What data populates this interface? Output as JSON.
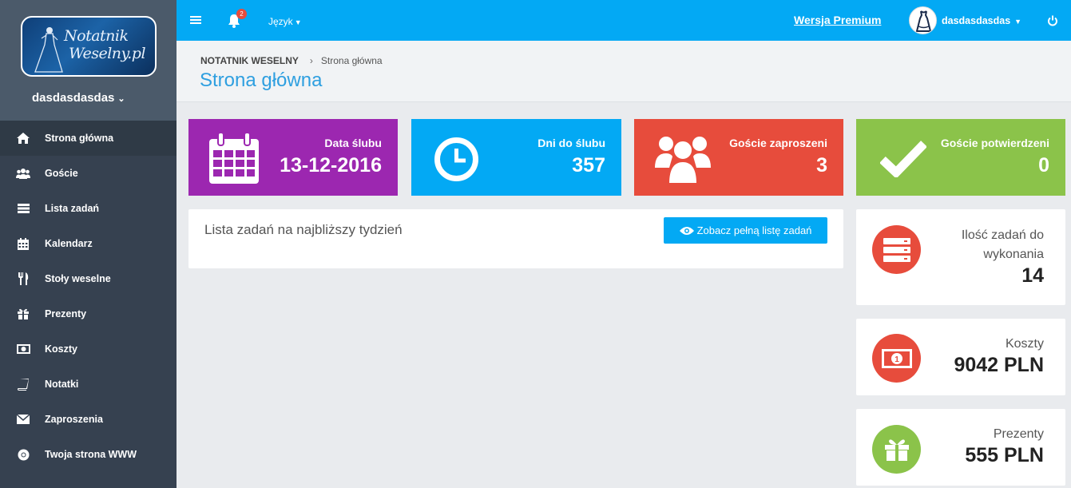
{
  "sidebar": {
    "logo_text_line1": "Notatnik",
    "logo_text_line2": "Weselny.pl",
    "user_name": "dasdasdasdas",
    "items": [
      {
        "label": "Strona główna",
        "icon": "home-icon"
      },
      {
        "label": "Goście",
        "icon": "users-icon"
      },
      {
        "label": "Lista zadań",
        "icon": "tasks-icon"
      },
      {
        "label": "Kalendarz",
        "icon": "calendar-icon"
      },
      {
        "label": "Stoły weselne",
        "icon": "cutlery-icon"
      },
      {
        "label": "Prezenty",
        "icon": "gift-icon"
      },
      {
        "label": "Koszty",
        "icon": "money-icon"
      },
      {
        "label": "Notatki",
        "icon": "book-icon"
      },
      {
        "label": "Zaproszenia",
        "icon": "envelope-icon"
      },
      {
        "label": "Twoja strona WWW",
        "icon": "chrome-icon"
      }
    ]
  },
  "topbar": {
    "notification_count": "2",
    "language_label": "Język",
    "premium_label": "Wersja Premium",
    "user_name": "dasdasdasdas"
  },
  "header": {
    "breadcrumb_root": "NOTATNIK WESELNY",
    "breadcrumb_current": "Strona główna",
    "title": "Strona główna"
  },
  "tiles": [
    {
      "label": "Data ślubu",
      "value": "13-12-2016",
      "color": "#9c27b0"
    },
    {
      "label": "Dni do ślubu",
      "value": "357",
      "color": "#03a9f4"
    },
    {
      "label": "Goście zaproszeni",
      "value": "3",
      "color": "#e74c3c"
    },
    {
      "label": "Goście potwierdzeni",
      "value": "0",
      "color": "#8bc34a"
    }
  ],
  "tasks": {
    "title": "Lista zadań na najbliższy tydzień",
    "button_label": "Zobacz pełną listę zadań"
  },
  "cards": [
    {
      "label_line1": "Ilość zadań do",
      "label_line2": "wykonania",
      "value": "14",
      "color": "#e74c3c"
    },
    {
      "label_line1": "Koszty",
      "value": "9042 PLN",
      "color": "#e74c3c"
    },
    {
      "label_line1": "Prezenty",
      "value": "555 PLN",
      "color": "#8bc34a"
    }
  ]
}
